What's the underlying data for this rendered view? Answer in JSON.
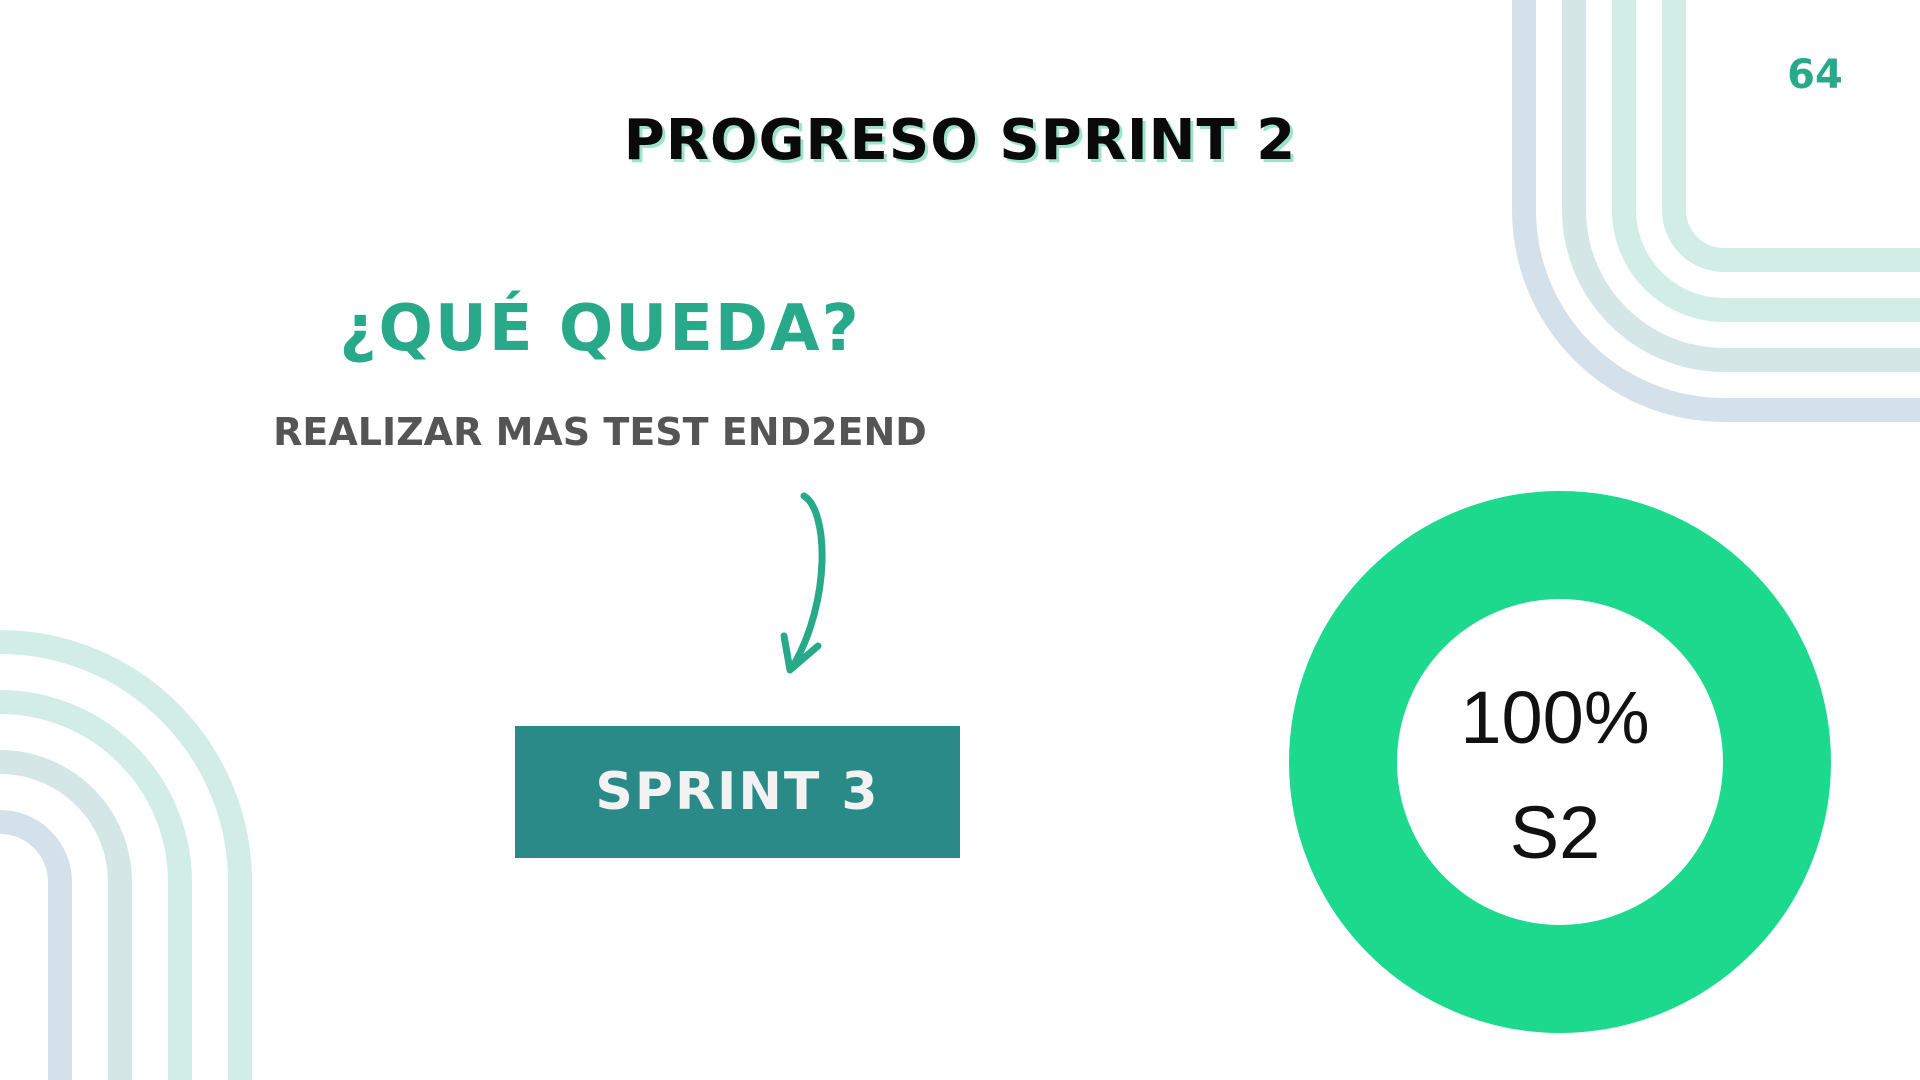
{
  "slide": {
    "page_number": "64",
    "title": "PROGRESO SPRINT 2",
    "subtitle": "¿QUÉ QUEDA?",
    "pending_item": "REALIZAR MAS TEST END2END",
    "next_button_label": "SPRINT 3"
  },
  "progress": {
    "value_text": "100%",
    "label": "S2",
    "value": 1.0
  },
  "colors": {
    "accent": "#27a98a",
    "donut": "#1cd98e",
    "button": "#2a8a88",
    "deco_teal": "#d2ede5",
    "deco_blue": "#d5e1ea"
  }
}
